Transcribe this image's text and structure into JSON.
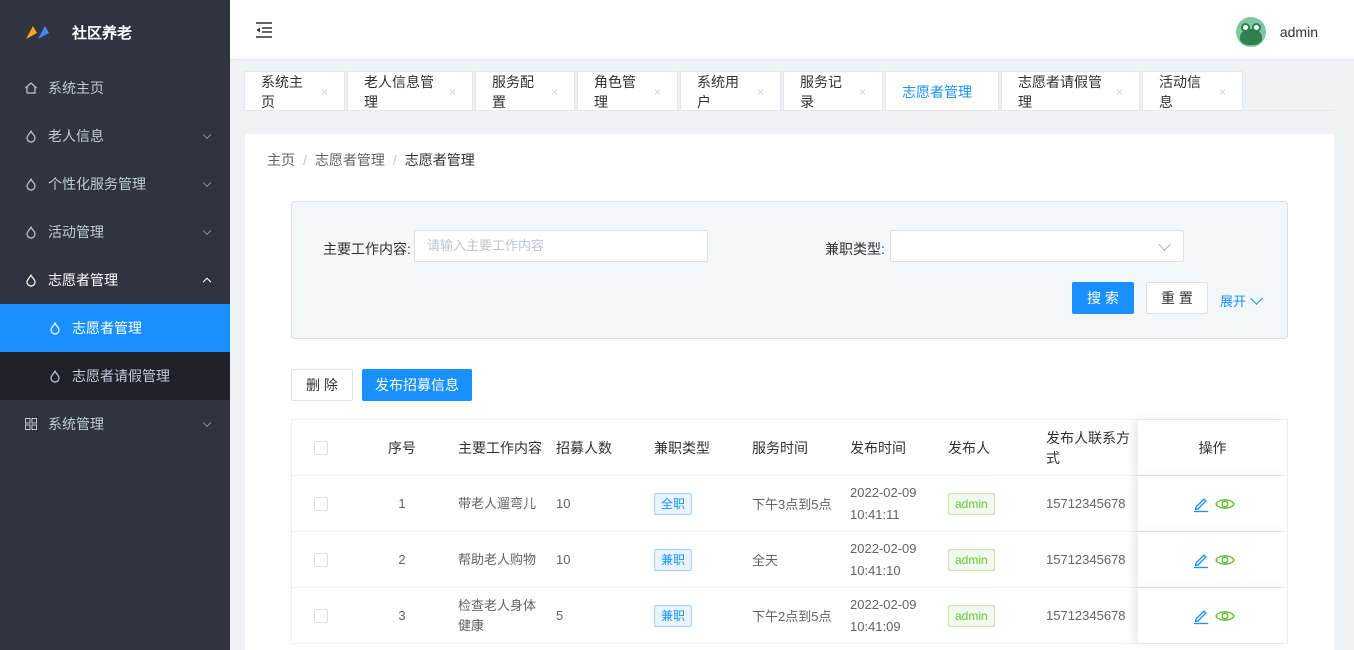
{
  "app": {
    "title": "社区养老"
  },
  "sidebar": {
    "items": [
      {
        "label": "系统主页",
        "icon": "home-icon"
      },
      {
        "label": "老人信息",
        "icon": "drop-icon"
      },
      {
        "label": "个性化服务管理",
        "icon": "drop-icon"
      },
      {
        "label": "活动管理",
        "icon": "drop-icon"
      },
      {
        "label": "志愿者管理",
        "icon": "drop-icon"
      },
      {
        "label": "系统管理",
        "icon": "grid-icon"
      }
    ],
    "sub_items": [
      {
        "label": "志愿者管理",
        "active": true
      },
      {
        "label": "志愿者请假管理",
        "active": false
      }
    ]
  },
  "header": {
    "user": "admin"
  },
  "tabs": [
    {
      "label": "系统主页"
    },
    {
      "label": "老人信息管理"
    },
    {
      "label": "服务配置"
    },
    {
      "label": "角色管理"
    },
    {
      "label": "系统用户"
    },
    {
      "label": "服务记录"
    },
    {
      "label": "志愿者管理",
      "active": true
    },
    {
      "label": "志愿者请假管理"
    },
    {
      "label": "活动信息"
    }
  ],
  "breadcrumb": {
    "home": "主页",
    "parent": "志愿者管理",
    "current": "志愿者管理",
    "sep": "/"
  },
  "search": {
    "content_label": "主要工作内容:",
    "content_placeholder": "请输入主要工作内容",
    "type_label": "兼职类型:",
    "search_button": "搜 索",
    "reset_button": "重 置",
    "expand_label": "展开"
  },
  "actions": {
    "delete_button": "删 除",
    "publish_button": "发布招募信息"
  },
  "table": {
    "headers": {
      "idx": "序号",
      "content": "主要工作内容",
      "count": "招募人数",
      "type": "兼职类型",
      "time": "服务时间",
      "pub": "发布时间",
      "user": "发布人",
      "phone": "发布人联系方式",
      "op": "操作"
    },
    "rows": [
      {
        "idx": "1",
        "content": "带老人遛弯儿",
        "count": "10",
        "type": "全职",
        "time": "下午3点到5点",
        "pub_date": "2022-02-09",
        "pub_time": "10:41:11",
        "user": "admin",
        "phone": "15712345678"
      },
      {
        "idx": "2",
        "content": "帮助老人购物",
        "count": "10",
        "type": "兼职",
        "time": "全天",
        "pub_date": "2022-02-09",
        "pub_time": "10:41:10",
        "user": "admin",
        "phone": "15712345678"
      },
      {
        "idx": "3",
        "content": "检查老人身体健康",
        "count": "5",
        "type": "兼职",
        "time": "下午2点到5点",
        "pub_date": "2022-02-09",
        "pub_time": "10:41:09",
        "user": "admin",
        "phone": "15712345678"
      }
    ]
  },
  "colors": {
    "primary": "#1890ff",
    "sidebar_bg": "#2f3440",
    "tag_green": "#67c23a"
  }
}
